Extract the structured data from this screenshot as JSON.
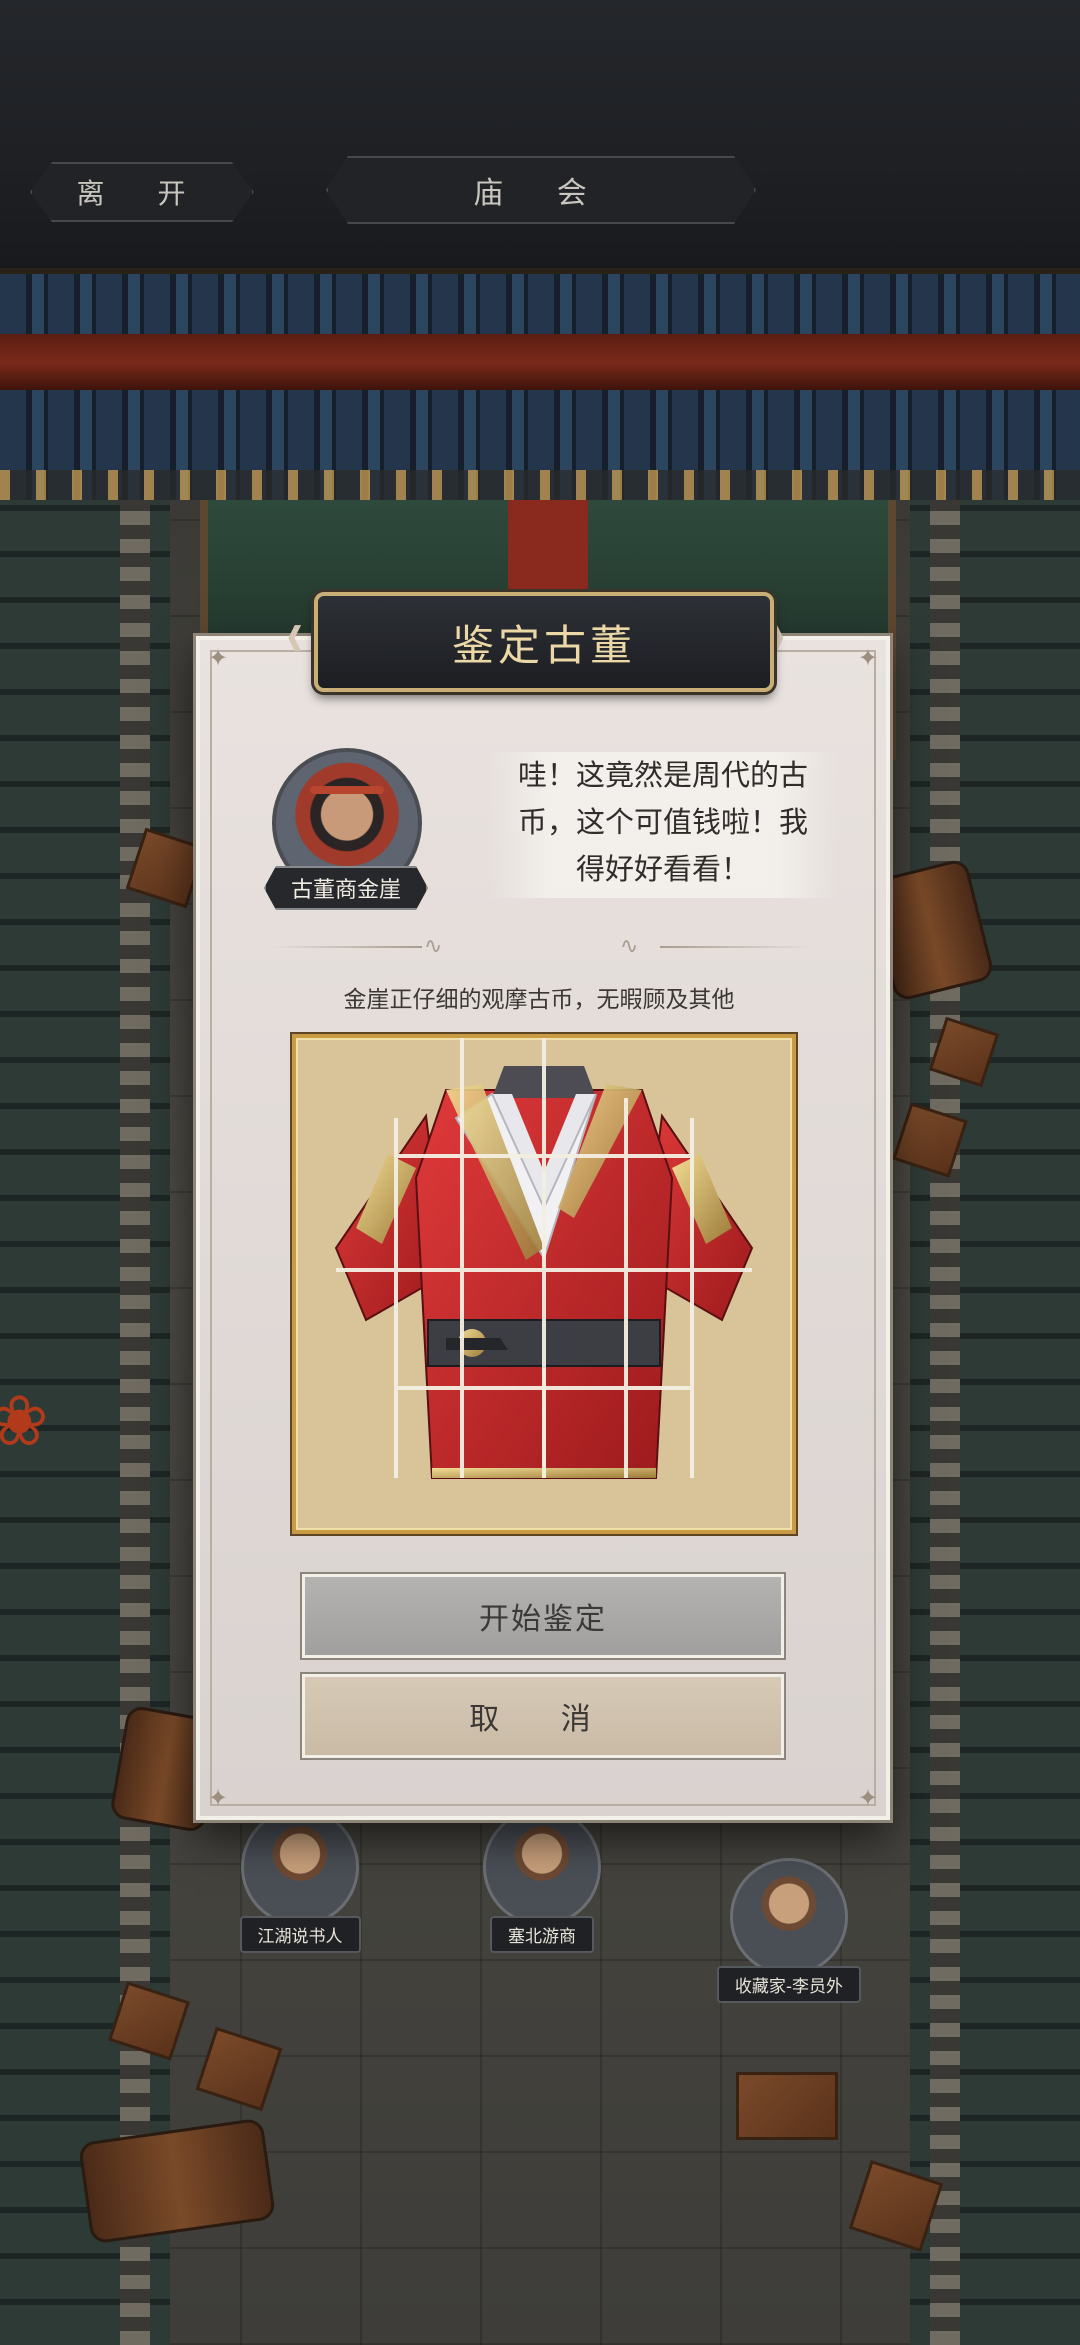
{
  "header": {
    "leave_label": "离 开",
    "location_title": "庙 会"
  },
  "dialog": {
    "title": "鉴定古董",
    "npc_name": "古董商金崖",
    "speech_lines": [
      "哇！这竟然是周代的古",
      "币，这个可值钱啦！我",
      "得好好看看！"
    ],
    "caption": "金崖正仔细的观摩古币，无暇顾及其他",
    "start_button": "开始鉴定",
    "cancel_button": "取 消"
  },
  "puzzle": {
    "item": "red-robe",
    "grid_columns": 5,
    "grid_rows": 4
  },
  "npcs": [
    {
      "name": "江湖说书人"
    },
    {
      "name": "塞北游商"
    },
    {
      "name": "收藏家-李员外"
    }
  ],
  "colors": {
    "dialog_bg": "#e5dedb",
    "title_gold": "#ecd8a6",
    "frame_gold": "#c89b44",
    "robe_red": "#c8282a"
  }
}
